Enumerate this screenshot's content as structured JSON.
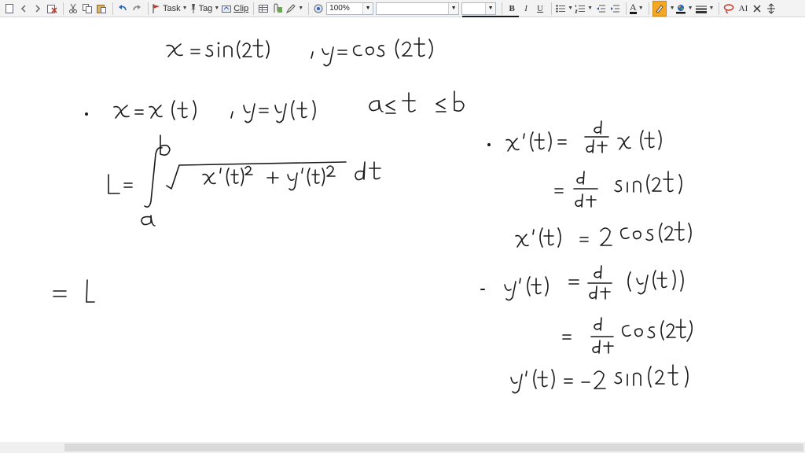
{
  "toolbar": {
    "task_label": "Task",
    "tag_label": "Tag",
    "clip_label": "Clip",
    "zoom_value": "100%",
    "font_value": "",
    "size_value": "",
    "bold_label": "B",
    "italic_label": "I",
    "underline_label": "U",
    "text_color_label": "A",
    "superscript_label": "AΙ"
  },
  "colors": {
    "ink": "#1a1a1a",
    "toolbar_bg": "#f3f3f3",
    "highlight": "#f5a623",
    "accent_red": "#c0392b",
    "accent_blue": "#2b63b5"
  }
}
